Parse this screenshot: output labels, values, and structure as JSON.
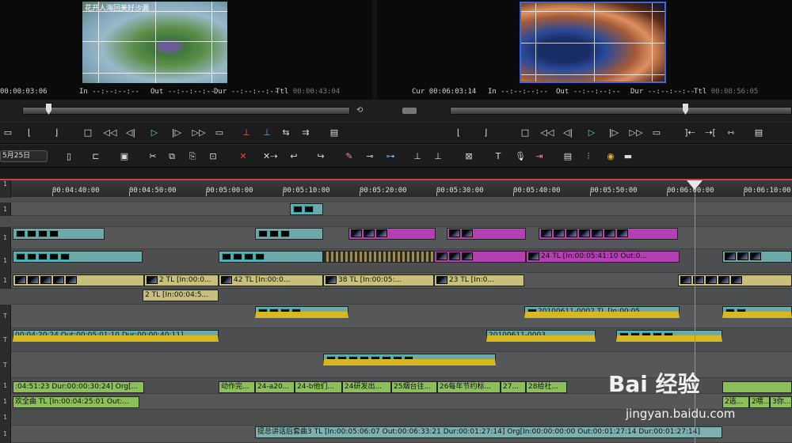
{
  "player": {
    "thumb_caption": "花开人海回美好沙漏",
    "tc": "00:00:03:06",
    "in_label": "In",
    "in_value": "--:--:--:--",
    "out_label": "Out",
    "out_value": "--:--:--:--",
    "dur_label": "Dur",
    "dur_value": "--:--:--:--",
    "ttl_label": "Ttl",
    "ttl_value": "00:00:43:04"
  },
  "recorder": {
    "cur_label": "Cur",
    "cur_value": "00:06:03:14",
    "in_label": "In",
    "in_value": "--:--:--:--",
    "out_label": "Out",
    "out_value": "--:--:--:--",
    "dur_label": "Dur",
    "dur_value": "--:--:--:--",
    "ttl_label": "Ttl",
    "ttl_value": "00:08:56:05"
  },
  "toolbar": {
    "date_field": "5月25日"
  },
  "ruler": {
    "ticks": [
      "00:04:40:00",
      "00:04:50:00",
      "00:05:00:00",
      "00:05:10:00",
      "00:05:20:00",
      "00:05:30:00",
      "00:05:40:00",
      "00:05:50:00",
      "00:06:00:00",
      "00:06:10:00"
    ]
  },
  "tracks": {
    "labels": [
      "1",
      "1",
      "1",
      "1",
      "1",
      "T",
      "T",
      "T",
      "1",
      "1",
      "1",
      "1"
    ],
    "clips": {
      "v1a_2": "2  TL [In:00:0...",
      "v1a_42": "42  TL [In:00:0...",
      "v1a_38": "38  TL [In:00:05:...",
      "v1a_23": "23  TL [In:0...",
      "v1_24": "24  TL [In:00:05:41:10 Out:0...",
      "a1_2": "2  TL [In:00:04:5...",
      "t1_clip": "20100611-0002  TL [In:00:05...",
      "t2_clip_a": "00:04:20:24 Out:00:05:01:10 Dur:00:00:40:11]",
      "t2_clip_b": "20100611-0003",
      "a_org": ":04:51:23 Dur:00:00:30:24]  Org[...",
      "a_c1": "动作完...",
      "a_c2": "24-a20...",
      "a_c3": "24-b他们...",
      "a_c4": "24研发出...",
      "a_c5": "25烟台往...",
      "a_c6": "26每年节约标...",
      "a_c7": "27...",
      "a_c8": "28给社...",
      "a_music": "欢全曲  TL [In:00:04:25:01 Out:...",
      "a_tail1": "2逃...",
      "a_tail2": "2喂...",
      "a_tail3": "3你...",
      "a_long": "提总讲话后套曲3  TL [In:00:05:06:07 Out:00:06:33:21 Dur:00:01:27:14]  Org[In:00:00:00:00 Out:00:01:27:14 Dur:00:01:27:14]"
    }
  },
  "watermark": {
    "brand": "Bai 经验",
    "url": "jingyan.baidu.com"
  },
  "colors": {
    "playhead": "#44aadd",
    "clip_teal": "#6fa8a8",
    "clip_magenta": "#b33fb3",
    "clip_green": "#8cbf5a",
    "clip_khaki": "#c8c07a"
  }
}
